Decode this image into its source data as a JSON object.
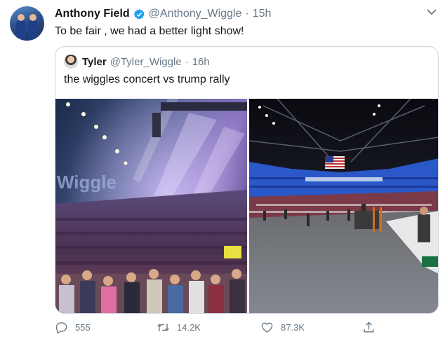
{
  "tweet": {
    "author_name": "Anthony Field",
    "author_handle": "@Anthony_Wiggle",
    "time": "15h",
    "text": "To be fair , we had a better light show!"
  },
  "quoted": {
    "author_name": "Tyler",
    "author_handle": "@Tyler_Wiggle",
    "time": "16h",
    "text": "the wiggles concert vs trump rally",
    "wiggles_sign": "Wiggle"
  },
  "actions": {
    "replies": "555",
    "retweets": "14.2K",
    "likes": "87.3K"
  },
  "icons": {
    "verified": "verified-badge-icon",
    "caret": "chevron-down-icon",
    "reply": "reply-icon",
    "retweet": "retweet-icon",
    "like": "heart-icon",
    "share": "share-icon"
  },
  "colors": {
    "verified_blue": "#1da1f2",
    "secondary_text": "#657786",
    "border": "#ccd6dd"
  }
}
